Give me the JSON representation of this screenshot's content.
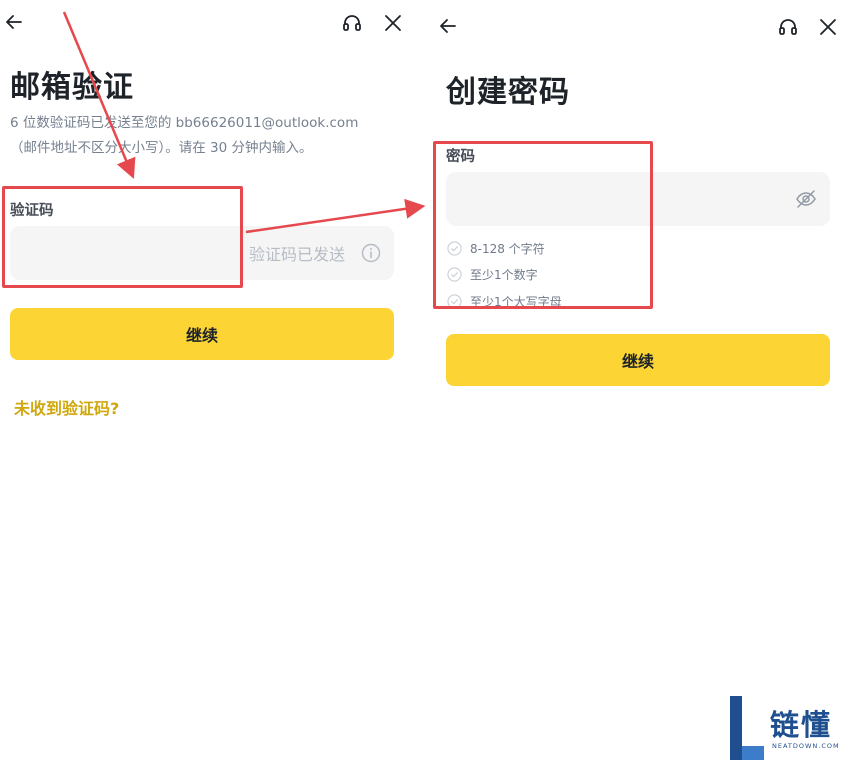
{
  "colors": {
    "accent": "#fcd535",
    "link": "#d0a80d",
    "annotation": "#e5484d",
    "field_bg": "#f5f5f5"
  },
  "left": {
    "icons": [
      "back-arrow-icon",
      "headset-icon",
      "close-icon"
    ],
    "title": "邮箱验证",
    "desc_line1": "6 位数验证码已发送至您的 bb66626011@outlook.com",
    "desc_line2": "（邮件地址不区分大小写）。请在 30 分钟内输入。",
    "code_label": "验证码",
    "code_value": "",
    "code_sent_hint": "验证码已发送",
    "continue_label": "继续",
    "resend_link": "未收到验证码?"
  },
  "right": {
    "icons": [
      "back-arrow-icon",
      "headset-icon",
      "close-icon"
    ],
    "title": "创建密码",
    "password_label": "密码",
    "password_value": "",
    "rules": [
      {
        "icon": "check-circle-icon",
        "text": "8-128 个字符"
      },
      {
        "icon": "check-circle-icon",
        "text": "至少1个数字"
      },
      {
        "icon": "check-circle-icon",
        "text": "至少1个大写字母"
      }
    ],
    "continue_label": "继续"
  },
  "watermark": {
    "name": "链懂",
    "domain": "NEATDOWN.COM"
  }
}
